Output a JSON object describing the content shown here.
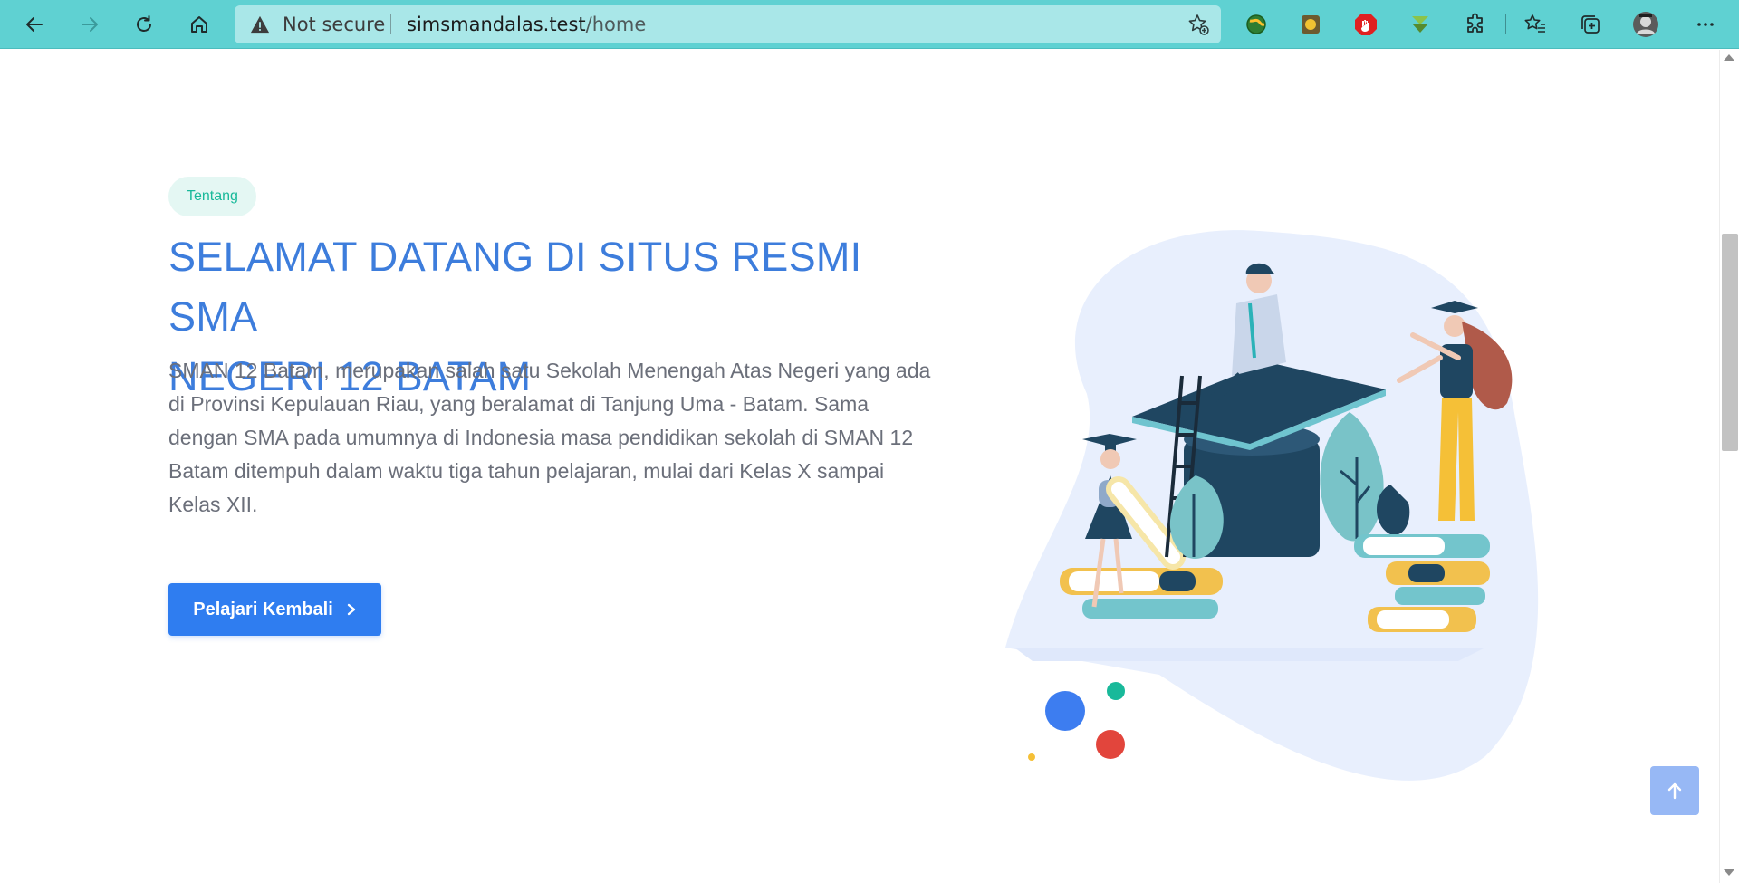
{
  "browser": {
    "security_label": "Not secure",
    "url_host": "simsmandalas.test",
    "url_path": "/home"
  },
  "hero": {
    "badge": "Tentang",
    "heading_line1": "SELAMAT DATANG DI SITUS RESMI SMA",
    "heading_line2": "NEGERI 12 BATAM",
    "paragraph": "SMAN 12 Batam, merupakan salah satu Sekolah Menengah Atas Negeri yang ada di Provinsi Kepulauan Riau, yang beralamat di Tanjung Uma - Batam. Sama dengan SMA pada umumnya di Indonesia masa pendidikan sekolah di SMAN 12 Batam ditempuh dalam waktu tiga tahun pelajaran, mulai dari Kelas X sampai Kelas XII.",
    "cta_label": "Pelajari Kembali"
  },
  "colors": {
    "toolbar": "#5fd1d2",
    "heading": "#3d7ddc",
    "button": "#2f7df0",
    "badge_text": "#19b99a",
    "badge_bg": "#e4f7f3"
  },
  "icons": {
    "back": "arrow-left-icon",
    "forward": "arrow-right-icon",
    "reload": "reload-icon",
    "home": "home-icon",
    "warning": "warning-icon",
    "favorite_add": "star-plus-icon",
    "extensions": "puzzle-icon",
    "favorites": "star-list-icon",
    "collections": "collections-icon",
    "profile": "avatar",
    "menu": "ellipsis-icon",
    "cta_arrow": "chevron-right-icon",
    "back_to_top": "arrow-up-icon"
  }
}
